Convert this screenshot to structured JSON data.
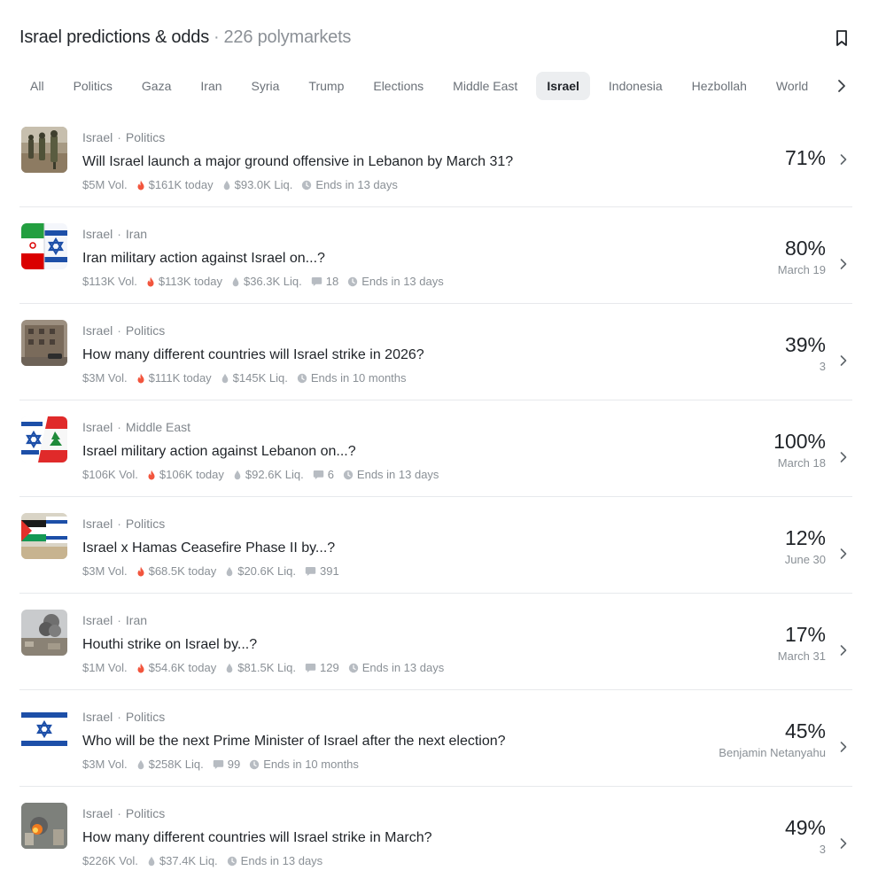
{
  "header": {
    "title": "Israel predictions & odds",
    "separator": "·",
    "count": "226 polymarkets"
  },
  "tabs": [
    "All",
    "Politics",
    "Gaza",
    "Iran",
    "Syria",
    "Trump",
    "Elections",
    "Middle East",
    "Israel",
    "Indonesia",
    "Hezbollah",
    "World"
  ],
  "active_tab": "Israel",
  "markets": [
    {
      "tags": [
        "Israel",
        "Politics"
      ],
      "question": "Will Israel launch a major ground offensive in Lebanon by March 31?",
      "volume": "$5M Vol.",
      "today": "$161K today",
      "liquidity": "$93.0K Liq.",
      "comments": "",
      "ends": "Ends in 13 days",
      "percent": "71%",
      "sub": "",
      "thumb": "soldiers"
    },
    {
      "tags": [
        "Israel",
        "Iran"
      ],
      "question": "Iran military action against Israel on...?",
      "volume": "$113K Vol.",
      "today": "$113K today",
      "liquidity": "$36.3K Liq.",
      "comments": "18",
      "ends": "Ends in 13 days",
      "percent": "80%",
      "sub": "March 19",
      "thumb": "iran-israel-flags"
    },
    {
      "tags": [
        "Israel",
        "Politics"
      ],
      "question": "How many different countries will Israel strike in 2026?",
      "volume": "$3M Vol.",
      "today": "$111K today",
      "liquidity": "$145K Liq.",
      "comments": "",
      "ends": "Ends in 10 months",
      "percent": "39%",
      "sub": "3",
      "thumb": "damaged-building"
    },
    {
      "tags": [
        "Israel",
        "Middle East"
      ],
      "question": "Israel military action against Lebanon on...?",
      "volume": "$106K Vol.",
      "today": "$106K today",
      "liquidity": "$92.6K Liq.",
      "comments": "6",
      "ends": "Ends in 13 days",
      "percent": "100%",
      "sub": "March 18",
      "thumb": "israel-lebanon-flags"
    },
    {
      "tags": [
        "Israel",
        "Politics"
      ],
      "question": "Israel x Hamas Ceasefire Phase II by...?",
      "volume": "$3M Vol.",
      "today": "$68.5K today",
      "liquidity": "$20.6K Liq.",
      "comments": "391",
      "ends": "",
      "percent": "12%",
      "sub": "June 30",
      "thumb": "palestine-israel-flags"
    },
    {
      "tags": [
        "Israel",
        "Iran"
      ],
      "question": "Houthi strike on Israel by...?",
      "volume": "$1M Vol.",
      "today": "$54.6K today",
      "liquidity": "$81.5K Liq.",
      "comments": "129",
      "ends": "Ends in 13 days",
      "percent": "17%",
      "sub": "March 31",
      "thumb": "smoke"
    },
    {
      "tags": [
        "Israel",
        "Politics"
      ],
      "question": "Who will be the next Prime Minister of Israel after the next election?",
      "volume": "$3M Vol.",
      "today": "",
      "liquidity": "$258K Liq.",
      "comments": "99",
      "ends": "Ends in 10 months",
      "percent": "45%",
      "sub": "Benjamin Netanyahu",
      "thumb": "israel-flag"
    },
    {
      "tags": [
        "Israel",
        "Politics"
      ],
      "question": "How many different countries will Israel strike in March?",
      "volume": "$226K Vol.",
      "today": "",
      "liquidity": "$37.4K Liq.",
      "comments": "",
      "ends": "Ends in 13 days",
      "percent": "49%",
      "sub": "3",
      "thumb": "explosion"
    }
  ],
  "colors": {
    "fire": "#f2553d",
    "muted": "#8a9096",
    "active_tab_bg": "#eceef0"
  }
}
